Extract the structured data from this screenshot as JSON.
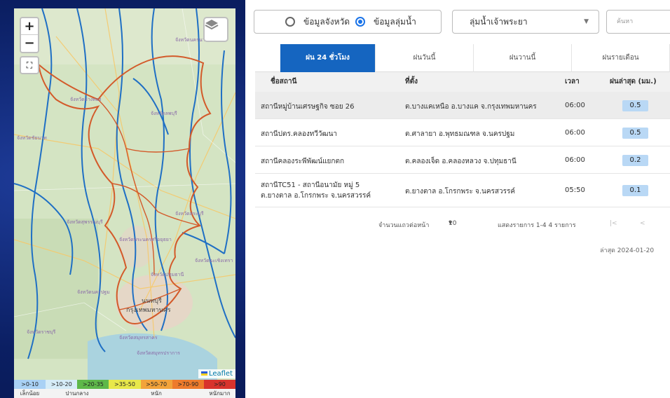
{
  "map": {
    "zoom_in": "+",
    "zoom_out": "−",
    "attribution": "Leaflet",
    "labels": [
      "จังหวัดนครนายก",
      "จังหวัดอ่างทอง",
      "จังหวัดลพบุรี",
      "จังหวัดสุพรรณบุรี",
      "จังหวัดสระบุรี",
      "จังหวัดพระนครศรีอยุธยา",
      "จังหวัดนครปฐม",
      "จังหวัดสมุทรสาคร",
      "จังหวัดสมุทรปราการ",
      "จังหวัดปทุมธานี",
      "นนทบุรี",
      "กรุงเทพมหานคร",
      "จังหวัดราชบุรี",
      "จังหวัดฉะเชิงเทรา",
      "จังหวัดชัยนาท"
    ]
  },
  "legend": {
    "ranges": [
      {
        "label": ">0-10",
        "color": "#a9d1f5"
      },
      {
        "label": ">10-20",
        "color": "#d6ecf8"
      },
      {
        "label": ">20-35",
        "color": "#5fb84a"
      },
      {
        "label": ">35-50",
        "color": "#e8e84a"
      },
      {
        "label": ">50-70",
        "color": "#f2a33a"
      },
      {
        "label": ">70-90",
        "color": "#ee7b2b"
      },
      {
        "label": ">90",
        "color": "#d8332c"
      }
    ],
    "levels": [
      "เล็กน้อย",
      "ปานกลาง",
      "หนัก",
      "หนักมาก"
    ]
  },
  "filters": {
    "radio_province": "ข้อมูลจังหวัด",
    "radio_basin": "ข้อมูลลุ่มน้ำ",
    "basin_value": "ลุ่มน้ำเจ้าพระยา",
    "search_placeholder": "ค้นหา"
  },
  "tabs": [
    "ฝน 24 ชั่วโมง",
    "ฝนวันนี้",
    "ฝนวานนี้",
    "ฝนรายเดือน"
  ],
  "table": {
    "headers": {
      "station": "ชื่อสถานี",
      "location": "ที่ตั้ง",
      "time": "เวลา",
      "rain": "ฝนล่าสุด (มม.)",
      "sort_icon": "↓"
    },
    "rows": [
      {
        "station": "สถานีหมู่บ้านเศรษฐกิจ ซอย 26",
        "station2": "",
        "location": "ต.บางแคเหนือ อ.บางแค จ.กรุงเทพมหานคร",
        "time": "06:00",
        "rain": "0.5"
      },
      {
        "station": "สถานีปตร.คลองทวีวัฒนา",
        "station2": "",
        "location": "ต.ศาลายา อ.พุทธมณฑล จ.นครปฐม",
        "time": "06:00",
        "rain": "0.5"
      },
      {
        "station": "สถานีคลองระพีพัฒน์แยกตก",
        "station2": "",
        "location": "ต.คลองเจ็ด อ.คลองหลวง จ.ปทุมธานี",
        "time": "06:00",
        "rain": "0.2"
      },
      {
        "station": "สถานีTC51 - สถานีอนามัย หมู่ 5",
        "station2": "ต.ยางตาล อ.โกรกพระ จ.นครสวรรค์",
        "location": "ต.ยางตาล อ.โกรกพระ จ.นครสวรรค์",
        "time": "05:50",
        "rain": "0.1"
      }
    ]
  },
  "pager": {
    "rows_per_page_label": "จำนวนแถวต่อหน้า",
    "rows_per_page": "10",
    "showing": "แสดงรายการ 1-4 4 รายการ",
    "first": "|<",
    "prev": "<"
  },
  "updated": "ล่าสุด 2024-01-20"
}
